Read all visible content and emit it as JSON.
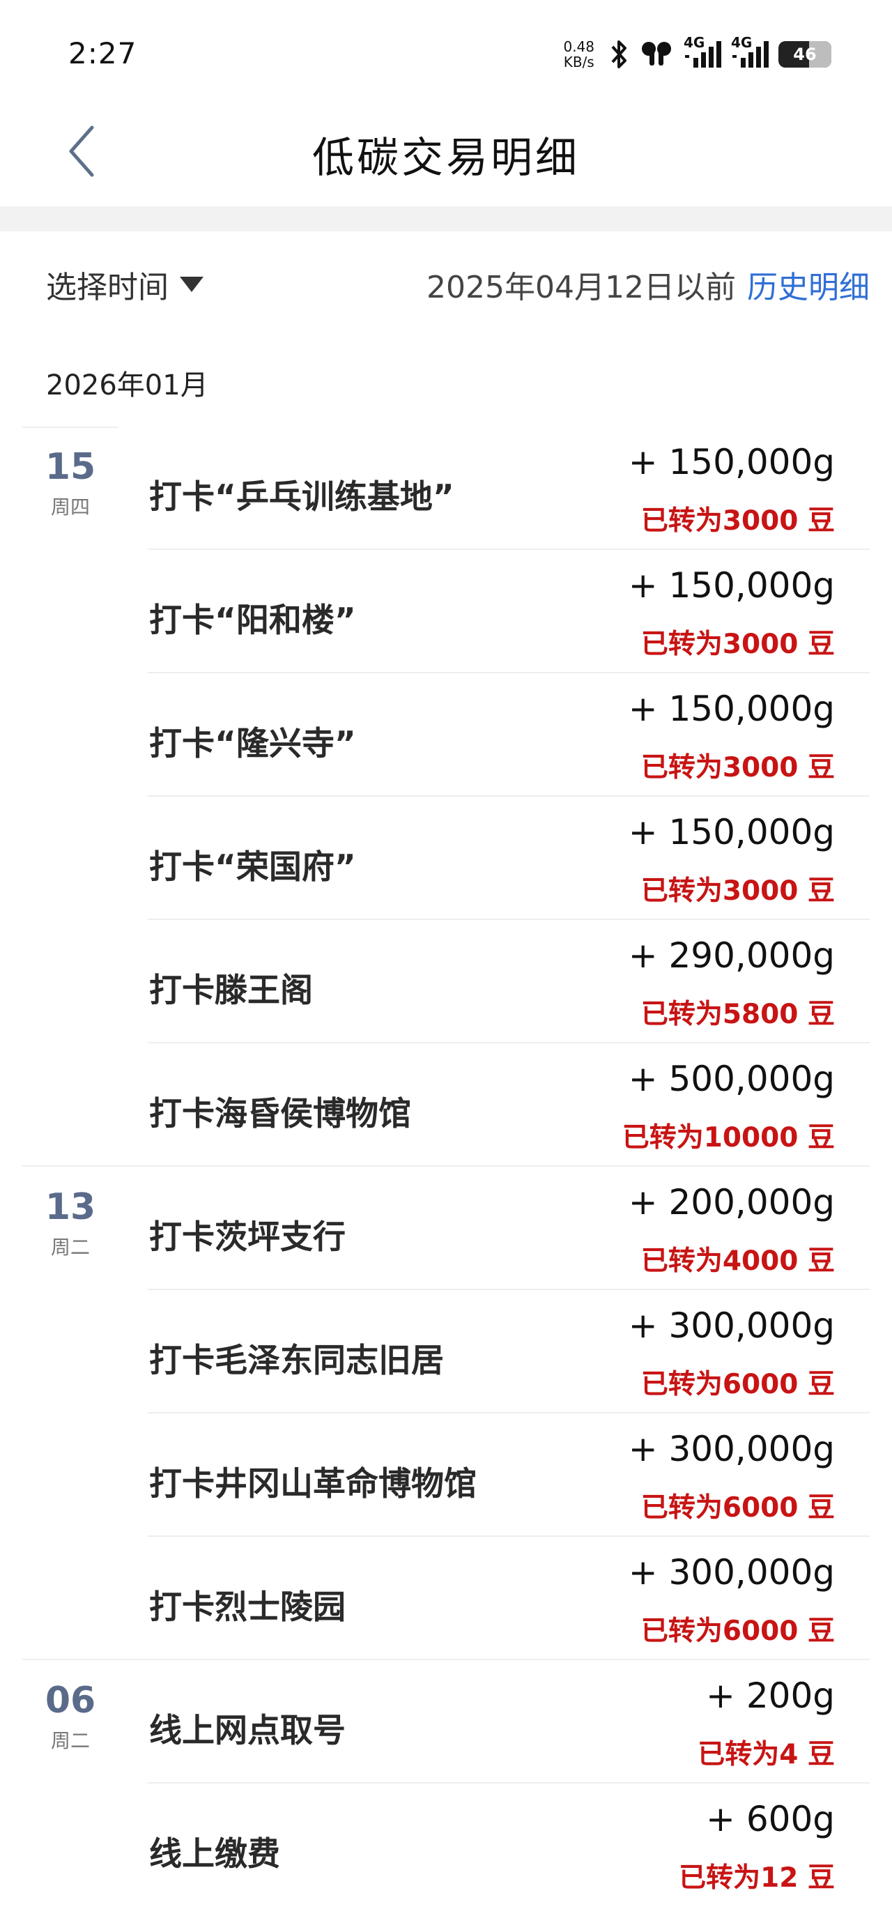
{
  "status_bar": {
    "time": "2:27",
    "net_speed_value": "0.48",
    "net_speed_unit": "KB/s",
    "signal1_label": "4G",
    "signal2_label": "4G",
    "battery": "46"
  },
  "header": {
    "title": "低碳交易明细"
  },
  "filter": {
    "select_label": "选择时间",
    "date_note": "2025年04月12日以前",
    "history_link": "历史明细"
  },
  "month": "2026年01月",
  "entries": [
    {
      "day": "15",
      "weekday": "周四",
      "title": "打卡“乒乓训练基地”",
      "amount": "+ 150,000g",
      "converted": "已转为3000 豆"
    },
    {
      "day": "",
      "weekday": "",
      "title": "打卡“阳和楼”",
      "amount": "+ 150,000g",
      "converted": "已转为3000 豆"
    },
    {
      "day": "",
      "weekday": "",
      "title": "打卡“隆兴寺”",
      "amount": "+ 150,000g",
      "converted": "已转为3000 豆"
    },
    {
      "day": "",
      "weekday": "",
      "title": "打卡“荣国府”",
      "amount": "+ 150,000g",
      "converted": "已转为3000 豆"
    },
    {
      "day": "",
      "weekday": "",
      "title": "打卡滕王阁",
      "amount": "+ 290,000g",
      "converted": "已转为5800 豆"
    },
    {
      "day": "",
      "weekday": "",
      "title": "打卡海昏侯博物馆",
      "amount": "+ 500,000g",
      "converted": "已转为10000 豆"
    },
    {
      "day": "13",
      "weekday": "周二",
      "title": "打卡茨坪支行",
      "amount": "+ 200,000g",
      "converted": "已转为4000 豆"
    },
    {
      "day": "",
      "weekday": "",
      "title": "打卡毛泽东同志旧居",
      "amount": "+ 300,000g",
      "converted": "已转为6000 豆"
    },
    {
      "day": "",
      "weekday": "",
      "title": "打卡井冈山革命博物馆",
      "amount": "+ 300,000g",
      "converted": "已转为6000 豆"
    },
    {
      "day": "",
      "weekday": "",
      "title": "打卡烈士陵园",
      "amount": "+ 300,000g",
      "converted": "已转为6000 豆"
    },
    {
      "day": "06",
      "weekday": "周二",
      "title": "线上网点取号",
      "amount": "+ 200g",
      "converted": "已转为4 豆"
    },
    {
      "day": "",
      "weekday": "",
      "title": "线上缴费",
      "amount": "+ 600g",
      "converted": "已转为12 豆"
    }
  ],
  "colors": {
    "link": "#2f6fd6",
    "converted": "#c81414",
    "date": "#5a6a8a"
  }
}
